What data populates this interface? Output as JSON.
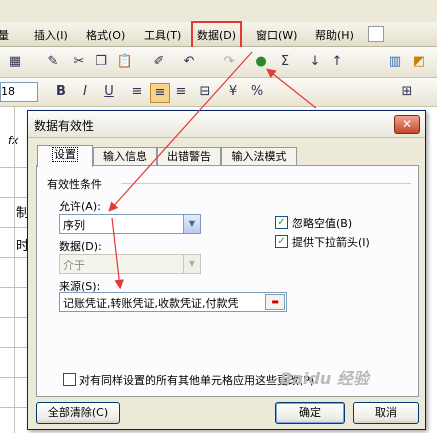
{
  "menu": {
    "items": [
      "插入(I)",
      "格式(O)",
      "工具(T)",
      "数据(D)",
      "窗口(W)",
      "帮助(H)"
    ],
    "highlighted": "数据(D)",
    "partial_left": "量"
  },
  "toolbar": {
    "font_size": "18"
  },
  "sheet": {
    "row_chars": [
      "制",
      "时"
    ],
    "fx": "fx"
  },
  "dialog": {
    "title": "数据有效性",
    "close_label": "✕",
    "tabs": [
      "设置",
      "输入信息",
      "出错警告",
      "输入法模式"
    ],
    "active_tab": "设置",
    "section_title": "有效性条件",
    "allow_label": "允许(A):",
    "allow_value": "序列",
    "data_label": "数据(D):",
    "data_value": "介于",
    "ignore_blank_label": "忽略空值(B)",
    "ignore_blank_checked": true,
    "dropdown_label": "提供下拉箭头(I)",
    "dropdown_checked": true,
    "source_label": "来源(S):",
    "source_value": "记账凭证,转账凭证,收款凭证,付款凭",
    "apply_all_label": "对有同样设置的所有其他单元格应用这些更改(P)",
    "apply_all_checked": false,
    "clear_all_button": "全部清除(C)",
    "ok_button": "确定",
    "cancel_button": "取消"
  },
  "watermark": "Baidu 经验",
  "colors": {
    "annotation_red": "#e53935",
    "title_text": "#000000"
  }
}
